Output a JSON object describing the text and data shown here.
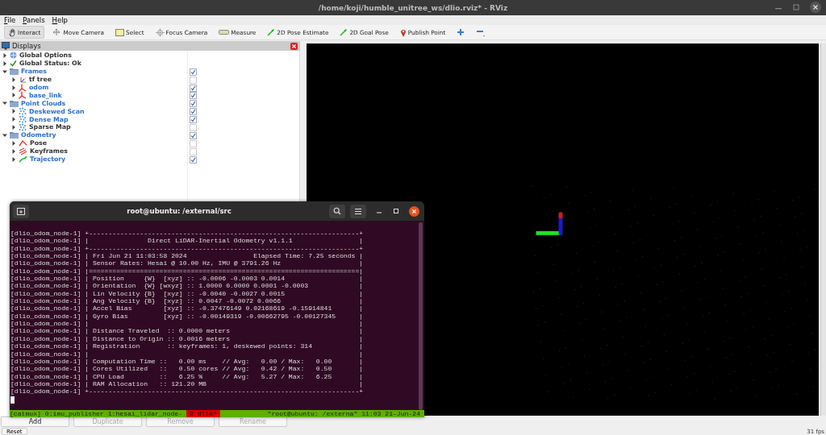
{
  "window": {
    "title": "/home/koji/humble_unitree_ws/dlio.rviz* - RViz"
  },
  "menu": [
    "File",
    "Panels",
    "Help"
  ],
  "tools": [
    {
      "label": "Interact",
      "kind": "hand",
      "selected": true
    },
    {
      "label": "Move Camera",
      "kind": "move",
      "selected": false
    },
    {
      "label": "Select",
      "kind": "select",
      "selected": false
    },
    {
      "label": "Focus Camera",
      "kind": "focus",
      "selected": false
    },
    {
      "label": "Measure",
      "kind": "measure",
      "selected": false
    },
    {
      "label": "2D Pose Estimate",
      "kind": "arrow",
      "selected": false
    },
    {
      "label": "2D Goal Pose",
      "kind": "arrow",
      "selected": false
    },
    {
      "label": "Publish Point",
      "kind": "pin",
      "selected": false
    },
    {
      "kind": "plus",
      "selected": false
    },
    {
      "kind": "minus",
      "selected": false
    }
  ],
  "displays_panel": {
    "title": "Displays",
    "items": [
      {
        "label": "Global Options",
        "kind": "globe",
        "expanded": false
      },
      {
        "label": "Global Status: Ok",
        "kind": "check",
        "expanded": false
      },
      {
        "label": "Frames",
        "kind": "folder",
        "expanded": true,
        "checked": true,
        "children": [
          {
            "label": "tf tree",
            "kind": "tf",
            "expanded": false,
            "checked": false
          },
          {
            "label": "odom",
            "kind": "axes",
            "expanded": false,
            "checked": true
          },
          {
            "label": "base_link",
            "kind": "axes",
            "expanded": false,
            "checked": true
          }
        ]
      },
      {
        "label": "Point Clouds",
        "kind": "folder",
        "expanded": true,
        "checked": true,
        "children": [
          {
            "label": "Deskewed Scan",
            "kind": "cloud",
            "expanded": false,
            "checked": true
          },
          {
            "label": "Dense Map",
            "kind": "cloud",
            "expanded": false,
            "checked": true
          },
          {
            "label": "Sparse Map",
            "kind": "cloud",
            "expanded": false,
            "checked": false
          }
        ]
      },
      {
        "label": "Odometry",
        "kind": "folder",
        "expanded": true,
        "checked": true,
        "children": [
          {
            "label": "Pose",
            "kind": "pose",
            "expanded": false,
            "checked": false
          },
          {
            "label": "Keyframes",
            "kind": "keyframes",
            "expanded": false,
            "checked": false
          },
          {
            "label": "Trajectory",
            "kind": "trajectory",
            "expanded": false,
            "checked": true
          }
        ]
      }
    ],
    "buttons": [
      {
        "label": "Add",
        "disabled": false
      },
      {
        "label": "Duplicate",
        "disabled": true
      },
      {
        "label": "Remove",
        "disabled": true
      },
      {
        "label": "Rename",
        "disabled": true
      }
    ]
  },
  "reset_button": "Reset",
  "fps": "31 fps",
  "terminal": {
    "title": "root@ubuntu: /external/src",
    "lines": [
      {
        "prefix": "[dlio_odom_node-1]",
        "left": "+",
        "body": "---------------------------------------------------------------------",
        "right": "+"
      },
      {
        "prefix": "[dlio_odom_node-1]",
        "left": "|",
        "body": "               Direct LiDAR-Inertial Odometry v1.1.1",
        "right": "|"
      },
      {
        "prefix": "[dlio_odom_node-1]",
        "left": "+",
        "body": "---------------------------------------------------------------------",
        "right": "+"
      },
      {
        "prefix": "[dlio_odom_node-1]",
        "left": "|",
        "body": " Fri Jun 21 11:03:58 2024                 Elapsed Time: 7.25 seconds",
        "right": "|"
      },
      {
        "prefix": "[dlio_odom_node-1]",
        "left": "|",
        "body": " Sensor Rates: Hesai @ 10.00 Hz, IMU @ 3791.26 Hz",
        "right": "|"
      },
      {
        "prefix": "[dlio_odom_node-1]",
        "left": "|",
        "body": "=====================================================================",
        "right": "|"
      },
      {
        "prefix": "[dlio_odom_node-1]",
        "left": "|",
        "body": " Position     {W}  [xyz] :: -0.0006 -0.0003 0.0014",
        "right": "|"
      },
      {
        "prefix": "[dlio_odom_node-1]",
        "left": "|",
        "body": " Orientation  {W} [wxyz] :: 1.0000 0.0000 0.0001 -0.0003",
        "right": "|"
      },
      {
        "prefix": "[dlio_odom_node-1]",
        "left": "|",
        "body": " Lin Velocity {B}  [xyz] :: -0.0040 -0.0027 0.0015",
        "right": "|"
      },
      {
        "prefix": "[dlio_odom_node-1]",
        "left": "|",
        "body": " Ang Velocity {B}  [xyz] :: 0.0047 -0.0072 0.0066",
        "right": "|"
      },
      {
        "prefix": "[dlio_odom_node-1]",
        "left": "|",
        "body": " Accel Bias        [xyz] :: -0.37476149 0.02168619 -0.15914841",
        "right": "|"
      },
      {
        "prefix": "[dlio_odom_node-1]",
        "left": "|",
        "body": " Gyro Bias         [xyz] :: -0.00149319 -0.00662795 -0.00127345",
        "right": "|"
      },
      {
        "prefix": "[dlio_odom_node-1]",
        "left": "|",
        "right": "|"
      },
      {
        "prefix": "[dlio_odom_node-1]",
        "left": "|",
        "body": " Distance Traveled  :: 0.0000 meters",
        "right": "|"
      },
      {
        "prefix": "[dlio_odom_node-1]",
        "left": "|",
        "body": " Distance to Origin :: 0.0016 meters",
        "right": "|"
      },
      {
        "prefix": "[dlio_odom_node-1]",
        "left": "|",
        "body": " Registration       :: keyframes: 1, deskewed points: 314",
        "right": "|"
      },
      {
        "prefix": "[dlio_odom_node-1]",
        "left": "|",
        "right": "|"
      },
      {
        "prefix": "[dlio_odom_node-1]",
        "left": "|",
        "body": " Computation Time ::   0.00 ms    // Avg:   0.00 / Max:   0.00",
        "right": "|"
      },
      {
        "prefix": "[dlio_odom_node-1]",
        "left": "|",
        "body": " Cores Utilized   ::   0.50 cores // Avg:   0.42 / Max:   0.50",
        "right": "|"
      },
      {
        "prefix": "[dlio_odom_node-1]",
        "left": "|",
        "body": " CPU Load         ::   6.25 %     // Avg:   5.27 / Max:   6.25",
        "right": "|"
      },
      {
        "prefix": "[dlio_odom_node-1]",
        "left": "|",
        "body": " RAM Allocation   :: 121.20 MB",
        "right": "|"
      },
      {
        "prefix": "[dlio_odom_node-1]",
        "left": "+",
        "body": "---------------------------------------------------------------------",
        "right": "+"
      }
    ],
    "status_bar": {
      "session": "[catmux]",
      "windows": [
        {
          "label": "0:imu_publisher",
          "selected": false
        },
        {
          "label": "1:hesai_lidar_node-",
          "selected": false
        },
        {
          "label": "2:dlio*",
          "selected": true
        }
      ],
      "right": "\"root@ubuntu: /externa\" 11:03 21-Jun-24"
    }
  }
}
